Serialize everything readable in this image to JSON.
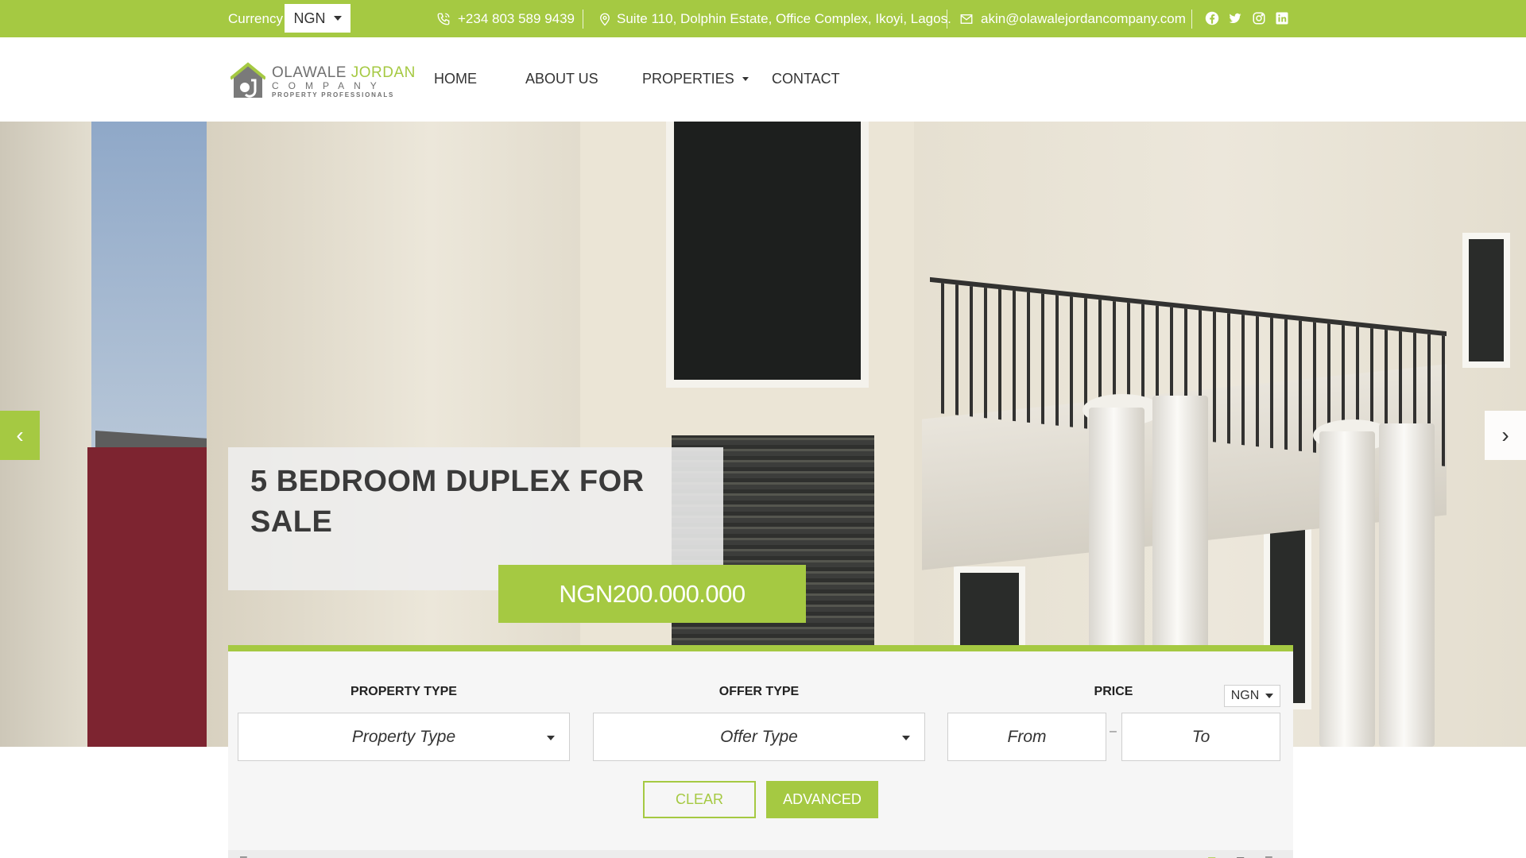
{
  "topbar": {
    "currency_label": "Currency",
    "currency_value": "NGN",
    "phone": "+234 803 589 9439",
    "address": "Suite 110, Dolphin Estate, Office Complex, Ikoyi, Lagos.",
    "email": "akin@olawalejordancompany.com",
    "social": [
      "facebook-icon",
      "twitter-icon",
      "instagram-icon",
      "linkedin-icon"
    ]
  },
  "logo": {
    "word1": "OLAWALE",
    "word2": "JORDAN",
    "line2": "COMPANY",
    "line3": "PROPERTY PROFESSIONALS"
  },
  "nav": {
    "items": [
      "HOME",
      "ABOUT US",
      "PROPERTIES",
      "CONTACT"
    ]
  },
  "hero": {
    "title": "5 BEDROOM DUPLEX FOR SALE",
    "price": "NGN200.000.000"
  },
  "search": {
    "property_type_label": "PROPERTY TYPE",
    "property_type_value": "Property Type",
    "offer_type_label": "OFFER TYPE",
    "offer_type_value": "Offer Type",
    "price_label": "PRICE",
    "price_currency": "NGN",
    "from_placeholder": "From",
    "to_placeholder": "To",
    "dash": "–",
    "clear_label": "CLEAR",
    "advanced_label": "ADVANCED"
  },
  "colors": {
    "accent": "#a5c942",
    "text_dark": "#333333"
  }
}
